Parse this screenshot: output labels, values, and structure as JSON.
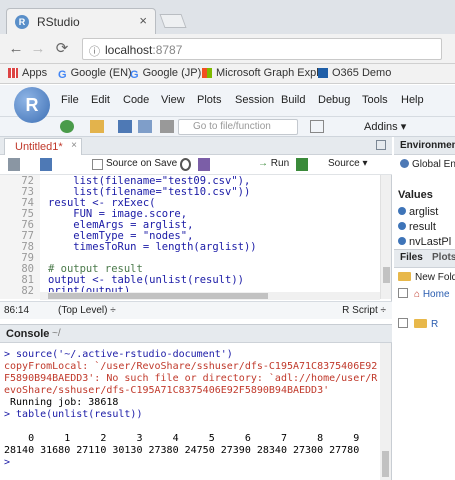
{
  "browser": {
    "tab_title": "RStudio",
    "tab_close": "×",
    "url_host": "localhost",
    "url_port": ":8787",
    "bookmarks": [
      {
        "label": "Apps",
        "icon": "apps-grid-icon"
      },
      {
        "label": "Google (EN)",
        "icon": "google-icon"
      },
      {
        "label": "Google (JP)",
        "icon": "google-icon"
      },
      {
        "label": "Microsoft Graph Explo",
        "icon": "microsoft-icon"
      },
      {
        "label": "O365 Demo",
        "icon": "office-icon"
      }
    ]
  },
  "rstudio": {
    "logo": "R",
    "menu": [
      "File",
      "Edit",
      "Code",
      "View",
      "Plots",
      "Session",
      "Build",
      "Debug",
      "Tools",
      "Help"
    ],
    "goto_placeholder": "Go to file/function",
    "addins": "Addins ▾"
  },
  "editor": {
    "tab_label": "Untitled1*",
    "source_on_save": "Source on Save",
    "run": "Run",
    "source": "Source ▾",
    "lines": [
      {
        "n": "72",
        "text": "    list(filename=\"test09.csv\"),"
      },
      {
        "n": "73",
        "text": "    list(filename=\"test10.csv\"))"
      },
      {
        "n": "74",
        "text": "result <- rxExec("
      },
      {
        "n": "75",
        "text": "    FUN = image.score,"
      },
      {
        "n": "76",
        "text": "    elemArgs = arglist,"
      },
      {
        "n": "77",
        "text": "    elemType = \"nodes\","
      },
      {
        "n": "78",
        "text": "    timesToRun = length(arglist))"
      },
      {
        "n": "79",
        "text": ""
      },
      {
        "n": "80",
        "text": "# output result"
      },
      {
        "n": "81",
        "text": "output <- table(unlist(result))"
      },
      {
        "n": "82",
        "text": "print(output)"
      }
    ],
    "cursor_pos": "86:14",
    "scope": "(Top Level) ÷",
    "file_type": "R Script ÷"
  },
  "console": {
    "title": "Console",
    "path": "~/",
    "lines": [
      {
        "text": "> source('~/.active-rstudio-document')",
        "cls": "blue"
      },
      {
        "text": "copyFromLocal: `/user/RevoShare/sshuser/dfs-C195A71C8375406E92",
        "cls": "red"
      },
      {
        "text": "F5890B94BAEDD3': No such file or directory: `adl://home/user/R",
        "cls": "red"
      },
      {
        "text": "evoShare/sshuser/dfs-C195A71C8375406E92F5890B94BAEDD3'",
        "cls": "red"
      },
      {
        "text": " Running job: 38618",
        "cls": "blk"
      },
      {
        "text": "> table(unlist(result))",
        "cls": "blue"
      },
      {
        "text": "",
        "cls": "blk"
      },
      {
        "text": "    0     1     2     3     4     5     6     7     8     9",
        "cls": "blk"
      },
      {
        "text": "28140 31680 27110 30130 27380 24750 27390 28340 27300 27780",
        "cls": "blk"
      },
      {
        "text": ">",
        "cls": "blue"
      }
    ]
  },
  "environment": {
    "title": "Environment",
    "global": "Global En",
    "values_header": "Values",
    "items": [
      "arglist",
      "result",
      "nvLastPl"
    ]
  },
  "files": {
    "tab_files": "Files",
    "tab_plots": "Plots",
    "new_folder": "New Folde",
    "home": "Home",
    "row_label": "R"
  }
}
